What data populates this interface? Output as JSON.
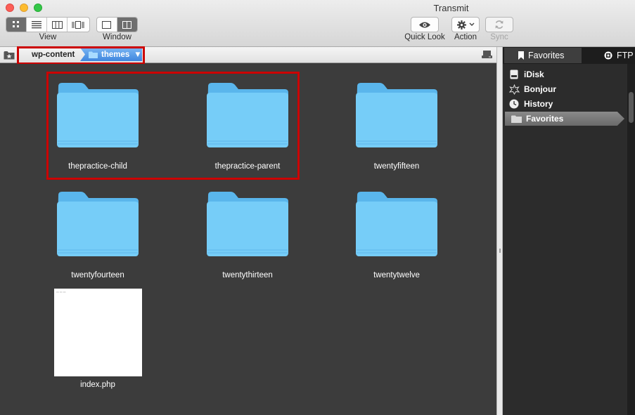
{
  "window": {
    "title": "Transmit"
  },
  "toolbar": {
    "view_label": "View",
    "window_label": "Window",
    "quick_look_label": "Quick Look",
    "action_label": "Action",
    "sync_label": "Sync",
    "view_modes": [
      "icon-view",
      "list-view",
      "column-view",
      "cover-flow-view"
    ],
    "active_view": "icon-view"
  },
  "pathbar": {
    "root": "wp-content",
    "current": "themes"
  },
  "files": [
    {
      "name": "thepractice-child",
      "type": "folder"
    },
    {
      "name": "thepractice-parent",
      "type": "folder"
    },
    {
      "name": "twentyfifteen",
      "type": "folder"
    },
    {
      "name": "twentyfourteen",
      "type": "folder"
    },
    {
      "name": "twentythirteen",
      "type": "folder"
    },
    {
      "name": "twentytwelve",
      "type": "folder"
    },
    {
      "name": "index.php",
      "type": "file"
    }
  ],
  "sidebar": {
    "tabs": [
      {
        "label": "Favorites",
        "active": true
      },
      {
        "label": "FTP",
        "active": false
      }
    ],
    "items": [
      {
        "label": "iDisk",
        "icon": "idisk-icon"
      },
      {
        "label": "Bonjour",
        "icon": "bonjour-icon"
      },
      {
        "label": "History",
        "icon": "history-icon"
      },
      {
        "label": "Favorites",
        "icon": "folder-icon",
        "selected": true
      }
    ]
  },
  "colors": {
    "folder": "#6ec9f7",
    "highlight": "#cc0000",
    "breadcrumb_active": "#4a8fe2"
  }
}
